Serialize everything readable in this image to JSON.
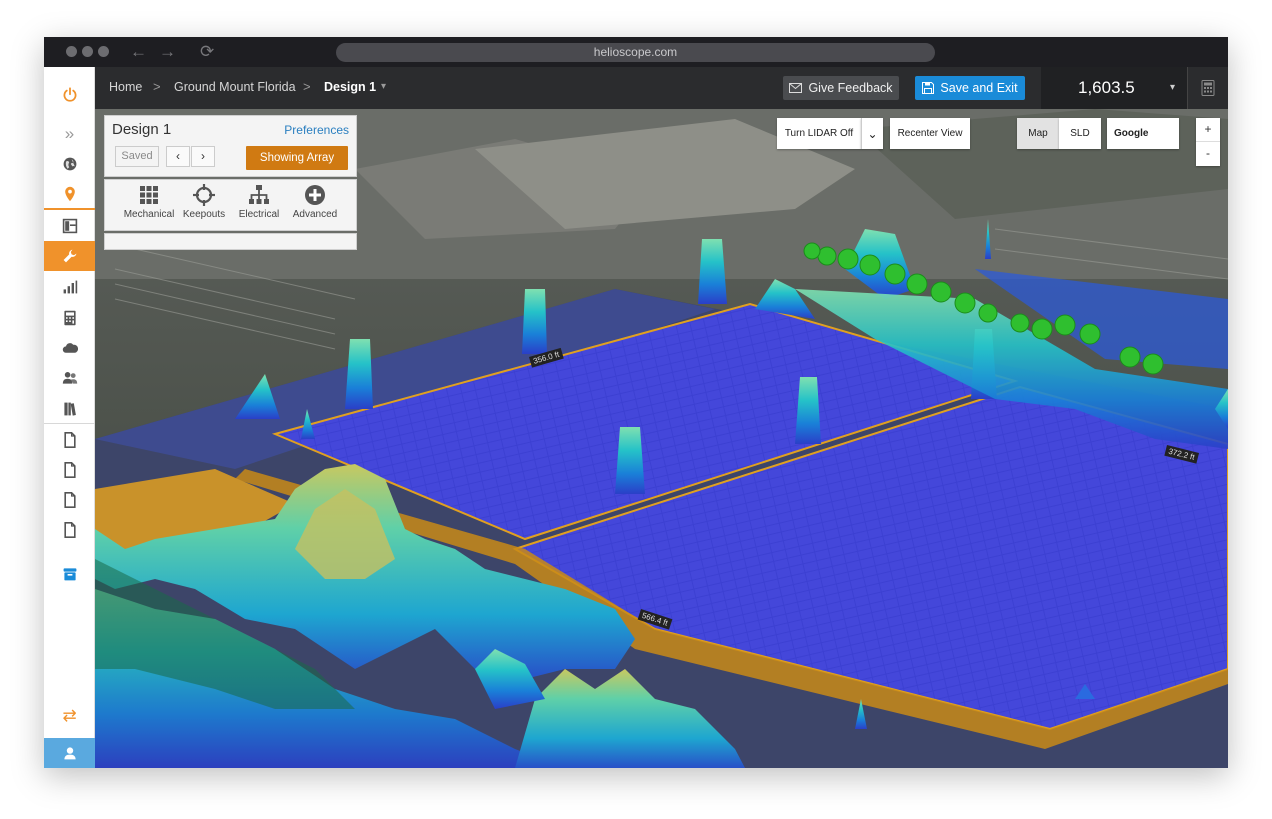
{
  "browser": {
    "url": "helioscope.com",
    "back_glyph": "←",
    "forward_glyph": "→",
    "reload_glyph": "⟳"
  },
  "breadcrumb": {
    "home": "Home",
    "project": "Ground Mount Florida",
    "design": "Design 1",
    "separator": ">",
    "caret": "▾"
  },
  "header": {
    "feedback_label": "Give Feedback",
    "save_label": "Save and Exit",
    "energy_value": "1,603.5",
    "energy_caret": "▾"
  },
  "sidebar": {
    "items": [
      "power-icon",
      "expand-icon",
      "globe-icon",
      "location-pin-icon",
      "layout-icon",
      "wrench-icon",
      "bar-chart-icon",
      "calculator-icon",
      "cloud-icon",
      "users-icon",
      "library-icon",
      "document-icon",
      "document-icon",
      "document-icon",
      "document-icon",
      "archive-icon",
      "swap-icon",
      "user-icon"
    ],
    "expand_glyph": "»",
    "swap_glyph": "⇄"
  },
  "design_panel": {
    "title": "Design 1",
    "preferences_label": "Preferences",
    "saved_label": "Saved",
    "prev_glyph": "‹",
    "next_glyph": "›",
    "array_label": "Showing Array",
    "tools": [
      {
        "label": "Mechanical",
        "icon": "grid-icon"
      },
      {
        "label": "Keepouts",
        "icon": "crosshair-icon"
      },
      {
        "label": "Electrical",
        "icon": "hierarchy-icon"
      },
      {
        "label": "Advanced",
        "icon": "plus-circle-icon"
      }
    ]
  },
  "map_controls": {
    "lidar_label": "Turn LIDAR Off",
    "lidar_caret": "⌄",
    "recenter_label": "Recenter View",
    "map_label": "Map",
    "sld_label": "SLD",
    "provider_label": "Google",
    "zoom_in": "+",
    "zoom_out": "-"
  },
  "dimensions": [
    "356.0 ft",
    "372.2 ft",
    "566.4 ft"
  ],
  "colors": {
    "accent": "#f0922b",
    "save_blue": "#1a8bd8",
    "array_orange": "#d07a12",
    "panel_blue": "#3b3fd0"
  }
}
